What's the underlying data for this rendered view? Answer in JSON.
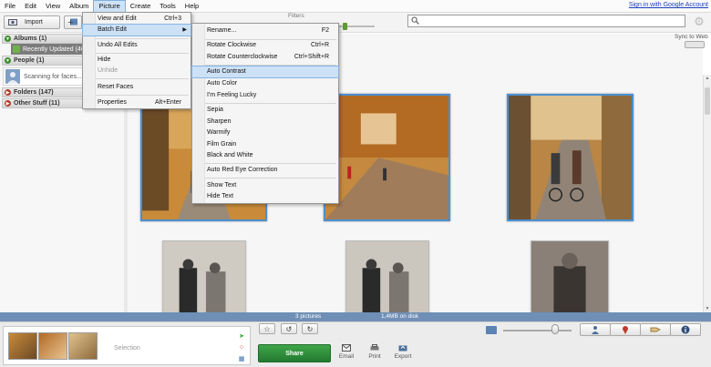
{
  "menubar": {
    "items": [
      "File",
      "Edit",
      "View",
      "Album",
      "Picture",
      "Create",
      "Tools",
      "Help"
    ],
    "active": "Picture",
    "sign_in": "Sign in with Google Account"
  },
  "toolbar": {
    "import_label": "Import",
    "filters_label": "Filters",
    "search_value": ""
  },
  "sidebar": {
    "albums": "Albums (1)",
    "recently_updated": "Recently Updated (46",
    "people": "People (1)",
    "scanning": "Scanning for faces...",
    "folders": "Folders (147)",
    "other": "Other Stuff (11)"
  },
  "sync": {
    "label": "Sync to Web"
  },
  "picture_menu": {
    "items": [
      {
        "label": "View and Edit",
        "shortcut": "Ctrl+3"
      },
      {
        "label": "Batch Edit",
        "shortcut": ""
      },
      {
        "label": "Undo All Edits",
        "shortcut": ""
      },
      {
        "label": "Hide",
        "shortcut": ""
      },
      {
        "label": "Unhide",
        "shortcut": ""
      },
      {
        "label": "Reset Faces",
        "shortcut": ""
      },
      {
        "label": "Properties",
        "shortcut": "Alt+Enter"
      }
    ]
  },
  "batch_menu": {
    "items": [
      {
        "label": "Rename...",
        "shortcut": "F2"
      },
      {
        "label": "Rotate Clockwise",
        "shortcut": "Ctrl+R"
      },
      {
        "label": "Rotate Counterclockwise",
        "shortcut": "Ctrl+Shift+R"
      },
      {
        "label": "Auto Contrast",
        "shortcut": ""
      },
      {
        "label": "Auto Color",
        "shortcut": ""
      },
      {
        "label": "I'm Feeling Lucky",
        "shortcut": ""
      },
      {
        "label": "Sepia",
        "shortcut": ""
      },
      {
        "label": "Sharpen",
        "shortcut": ""
      },
      {
        "label": "Warmify",
        "shortcut": ""
      },
      {
        "label": "Film Grain",
        "shortcut": ""
      },
      {
        "label": "Black and White",
        "shortcut": ""
      },
      {
        "label": "Auto Red Eye Correction",
        "shortcut": ""
      },
      {
        "label": "Show Text",
        "shortcut": ""
      },
      {
        "label": "Hide Text",
        "shortcut": ""
      }
    ],
    "highlighted": "Auto Contrast"
  },
  "status": {
    "count": "3 pictures",
    "size": "1,4MB on disk"
  },
  "bottom": {
    "selection_label": "Selection",
    "share_label": "Share",
    "actions": [
      "Email",
      "Print",
      "Export"
    ]
  },
  "colors": {
    "selection_border": "#4b8fd1",
    "share_green": "#2f8f3c",
    "menu_highlight": "#cce1f6",
    "status_bar": "#6f8fb6"
  }
}
